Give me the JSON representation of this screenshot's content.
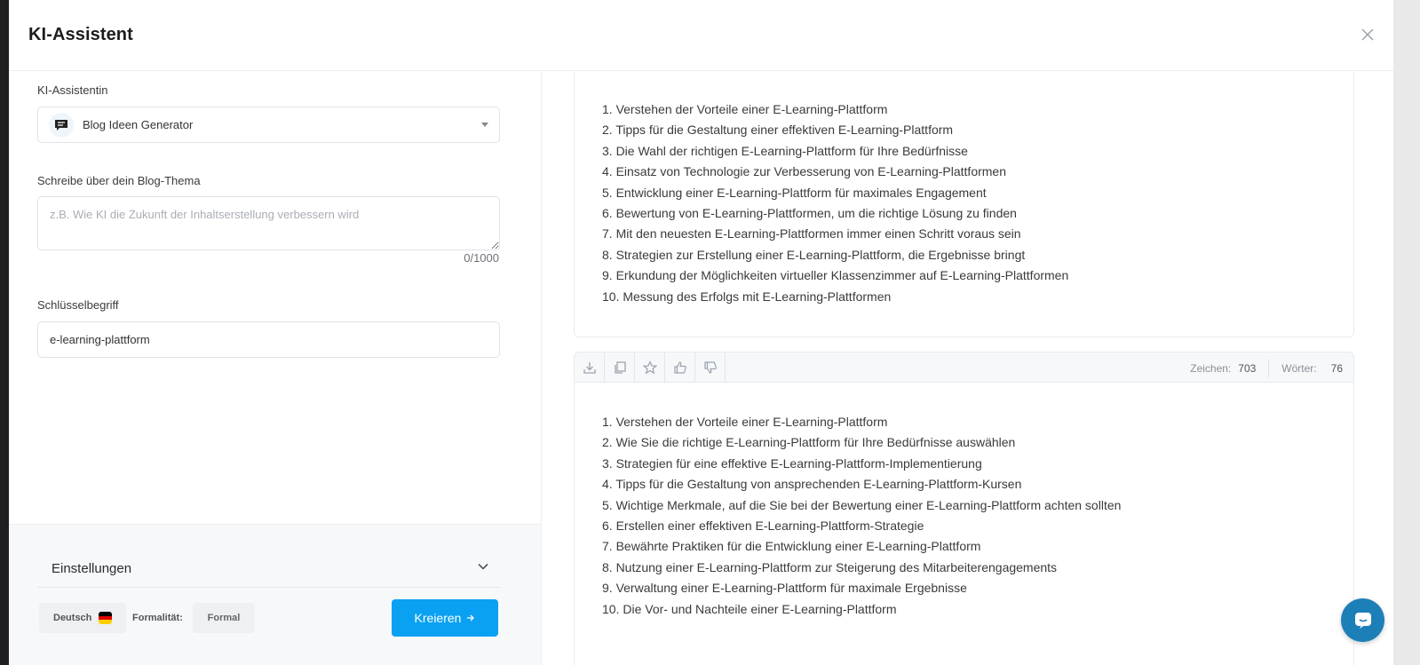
{
  "modal": {
    "title": "KI-Assistent"
  },
  "assistant": {
    "label": "KI-Assistentin",
    "selected": "Blog Ideen Generator"
  },
  "topic": {
    "label": "Schreibe über dein Blog-Thema",
    "placeholder": "z.B. Wie KI die Zukunft der Inhaltserstellung verbessern wird",
    "value": "",
    "counter": "0/1000"
  },
  "keyword": {
    "label": "Schlüsselbegriff",
    "value": "e-learning-plattform"
  },
  "settings": {
    "label": "Einstellungen",
    "language": "Deutsch",
    "formality_label": "Formalität:",
    "formality_value": "Formal",
    "create_label": "Kreieren"
  },
  "results": [
    {
      "items": [
        "1. Verstehen der Vorteile einer E-Learning-Plattform",
        "2. Tipps für die Gestaltung einer effektiven E-Learning-Plattform",
        "3. Die Wahl der richtigen E-Learning-Plattform für Ihre Bedürfnisse",
        "4. Einsatz von Technologie zur Verbesserung von E-Learning-Plattformen",
        "5. Entwicklung einer E-Learning-Plattform für maximales Engagement",
        "6. Bewertung von E-Learning-Plattformen, um die richtige Lösung zu finden",
        "7. Mit den neuesten E-Learning-Plattformen immer einen Schritt voraus sein",
        "8. Strategien zur Erstellung einer E-Learning-Plattform, die Ergebnisse bringt",
        "9. Erkundung der Möglichkeiten virtueller Klassenzimmer auf E-Learning-Plattformen",
        "10. Messung des Erfolgs mit E-Learning-Plattformen"
      ]
    },
    {
      "stats": {
        "chars_label": "Zeichen:",
        "chars": "703",
        "words_label": "Wörter:",
        "words": "76"
      },
      "items": [
        "1. Verstehen der Vorteile einer E-Learning-Plattform",
        "2. Wie Sie die richtige E-Learning-Plattform für Ihre Bedürfnisse auswählen",
        "3. Strategien für eine effektive E-Learning-Plattform-Implementierung",
        "4. Tipps für die Gestaltung von ansprechenden E-Learning-Plattform-Kursen",
        "5. Wichtige Merkmale, auf die Sie bei der Bewertung einer E-Learning-Plattform achten sollten",
        "6. Erstellen einer effektiven E-Learning-Plattform-Strategie",
        "7. Bewährte Praktiken für die Entwicklung einer E-Learning-Plattform",
        "8. Nutzung einer E-Learning-Plattform zur Steigerung des Mitarbeiterengagements",
        "9. Verwaltung einer E-Learning-Plattform für maximale Ergebnisse",
        "10. Die Vor- und Nachteile einer E-Learning-Plattform"
      ]
    }
  ],
  "icons": {
    "close": "close-icon",
    "assistant": "chat-message-icon",
    "caret": "caret-down-icon",
    "settings_chevron": "chevron-down-icon",
    "flag": "german-flag-icon",
    "arrow": "arrow-right-icon",
    "download": "download-icon",
    "copy": "copy-icon",
    "favorite": "star-icon",
    "like": "thumbs-up-icon",
    "dislike": "thumbs-down-icon",
    "chat": "chat-widget-icon"
  },
  "colors": {
    "accent": "#0aa1f2",
    "chat": "#1d7fb8"
  }
}
